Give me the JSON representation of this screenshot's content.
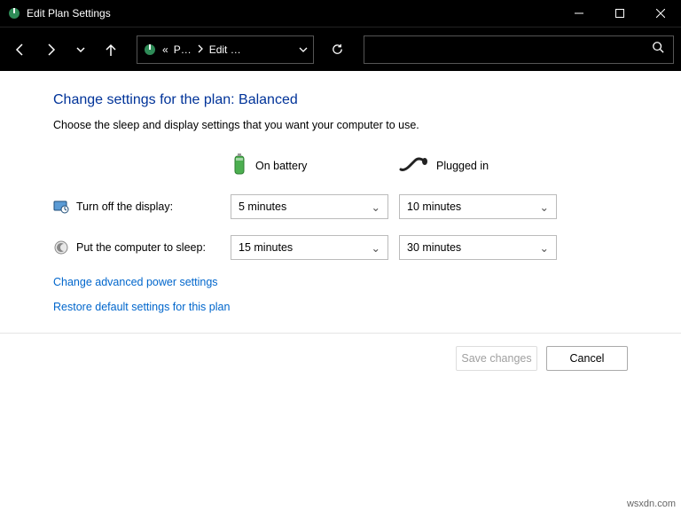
{
  "window": {
    "title": "Edit Plan Settings"
  },
  "breadcrumb": {
    "prefix": "«",
    "parent": "P…",
    "current": "Edit …"
  },
  "page": {
    "heading": "Change settings for the plan: Balanced",
    "sub": "Choose the sleep and display settings that you want your computer to use.",
    "col_battery": "On battery",
    "col_plugged": "Plugged in"
  },
  "rows": {
    "display": {
      "label": "Turn off the display:",
      "battery": "5 minutes",
      "plugged": "10 minutes"
    },
    "sleep": {
      "label": "Put the computer to sleep:",
      "battery": "15 minutes",
      "plugged": "30 minutes"
    }
  },
  "links": {
    "advanced": "Change advanced power settings",
    "restore": "Restore default settings for this plan"
  },
  "buttons": {
    "save": "Save changes",
    "cancel": "Cancel"
  },
  "watermark": "wsxdn.com"
}
